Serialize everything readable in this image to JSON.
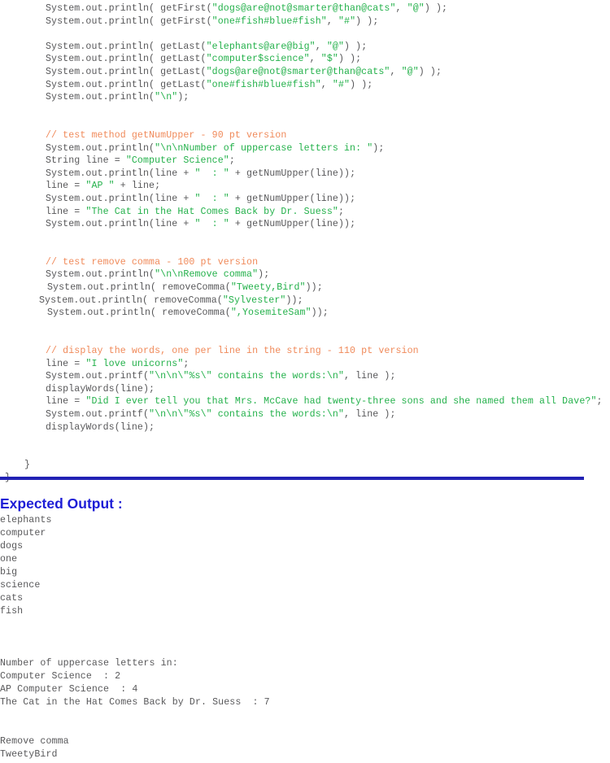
{
  "document": {
    "type": "java-source-listing-with-expected-output",
    "divider_color": "#2222b4",
    "code_text_color": "#58585a",
    "string_literal_color": "#24b14b",
    "comment_color": "#f08a5a",
    "heading_color": "#1d1dd6"
  },
  "code": {
    "lines": [
      {
        "indent": 56,
        "parts": [
          {
            "t": "plain",
            "s": "System.out.println( getFirst("
          },
          {
            "t": "str",
            "s": "\"dogs@are@not@smarter@than@cats\""
          },
          {
            "t": "plain",
            "s": ", "
          },
          {
            "t": "str",
            "s": "\"@\""
          },
          {
            "t": "plain",
            "s": ") );"
          }
        ]
      },
      {
        "indent": 56,
        "parts": [
          {
            "t": "plain",
            "s": "System.out.println( getFirst("
          },
          {
            "t": "str",
            "s": "\"one#fish#blue#fish\""
          },
          {
            "t": "plain",
            "s": ", "
          },
          {
            "t": "str",
            "s": "\"#\""
          },
          {
            "t": "plain",
            "s": ") );"
          }
        ]
      },
      {
        "indent": 0,
        "blank": true,
        "parts": []
      },
      {
        "indent": 56,
        "parts": [
          {
            "t": "plain",
            "s": "System.out.println( getLast("
          },
          {
            "t": "str",
            "s": "\"elephants@are@big\""
          },
          {
            "t": "plain",
            "s": ", "
          },
          {
            "t": "str",
            "s": "\"@\""
          },
          {
            "t": "plain",
            "s": ") );"
          }
        ]
      },
      {
        "indent": 56,
        "parts": [
          {
            "t": "plain",
            "s": "System.out.println( getLast("
          },
          {
            "t": "str",
            "s": "\"computer$science\""
          },
          {
            "t": "plain",
            "s": ", "
          },
          {
            "t": "str",
            "s": "\"$\""
          },
          {
            "t": "plain",
            "s": ") );"
          }
        ]
      },
      {
        "indent": 56,
        "parts": [
          {
            "t": "plain",
            "s": "System.out.println( getLast("
          },
          {
            "t": "str",
            "s": "\"dogs@are@not@smarter@than@cats\""
          },
          {
            "t": "plain",
            "s": ", "
          },
          {
            "t": "str",
            "s": "\"@\""
          },
          {
            "t": "plain",
            "s": ") );"
          }
        ]
      },
      {
        "indent": 56,
        "parts": [
          {
            "t": "plain",
            "s": "System.out.println( getLast("
          },
          {
            "t": "str",
            "s": "\"one#fish#blue#fish\""
          },
          {
            "t": "plain",
            "s": ", "
          },
          {
            "t": "str",
            "s": "\"#\""
          },
          {
            "t": "plain",
            "s": ") );"
          }
        ]
      },
      {
        "indent": 56,
        "parts": [
          {
            "t": "plain",
            "s": "System.out.println("
          },
          {
            "t": "str",
            "s": "\"\\n\""
          },
          {
            "t": "plain",
            "s": ");"
          }
        ]
      },
      {
        "indent": 0,
        "blank": true,
        "parts": []
      },
      {
        "indent": 0,
        "blank": true,
        "parts": []
      },
      {
        "indent": 56,
        "parts": [
          {
            "t": "cmt",
            "s": "// test method getNumUpper - 90 pt version"
          }
        ]
      },
      {
        "indent": 56,
        "parts": [
          {
            "t": "plain",
            "s": "System.out.println("
          },
          {
            "t": "str",
            "s": "\"\\n\\nNumber of uppercase letters in: \""
          },
          {
            "t": "plain",
            "s": ");"
          }
        ]
      },
      {
        "indent": 56,
        "parts": [
          {
            "t": "plain",
            "s": "String line = "
          },
          {
            "t": "str",
            "s": "\"Computer Science\""
          },
          {
            "t": "plain",
            "s": ";"
          }
        ]
      },
      {
        "indent": 56,
        "parts": [
          {
            "t": "plain",
            "s": "System.out.println(line + "
          },
          {
            "t": "str",
            "s": "\"  : \""
          },
          {
            "t": "plain",
            "s": " + getNumUpper(line));"
          }
        ]
      },
      {
        "indent": 56,
        "parts": [
          {
            "t": "plain",
            "s": "line = "
          },
          {
            "t": "str",
            "s": "\"AP \""
          },
          {
            "t": "plain",
            "s": " + line;"
          }
        ]
      },
      {
        "indent": 56,
        "parts": [
          {
            "t": "plain",
            "s": "System.out.println(line + "
          },
          {
            "t": "str",
            "s": "\"  : \""
          },
          {
            "t": "plain",
            "s": " + getNumUpper(line));"
          }
        ]
      },
      {
        "indent": 56,
        "parts": [
          {
            "t": "plain",
            "s": "line = "
          },
          {
            "t": "str",
            "s": "\"The Cat in the Hat Comes Back by Dr. Suess\""
          },
          {
            "t": "plain",
            "s": ";"
          }
        ]
      },
      {
        "indent": 56,
        "parts": [
          {
            "t": "plain",
            "s": "System.out.println(line + "
          },
          {
            "t": "str",
            "s": "\"  : \""
          },
          {
            "t": "plain",
            "s": " + getNumUpper(line));"
          }
        ]
      },
      {
        "indent": 0,
        "blank": true,
        "parts": []
      },
      {
        "indent": 0,
        "blank": true,
        "parts": []
      },
      {
        "indent": 56,
        "parts": [
          {
            "t": "cmt",
            "s": "// test remove comma - 100 pt version"
          }
        ]
      },
      {
        "indent": 56,
        "parts": [
          {
            "t": "plain",
            "s": "System.out.println("
          },
          {
            "t": "str",
            "s": "\"\\n\\nRemove comma\""
          },
          {
            "t": "plain",
            "s": ");"
          }
        ]
      },
      {
        "indent": 58,
        "parts": [
          {
            "t": "plain",
            "s": "System.out.println( removeComma("
          },
          {
            "t": "str",
            "s": "\"Tweety,Bird\""
          },
          {
            "t": "plain",
            "s": "));"
          }
        ]
      },
      {
        "indent": 48,
        "parts": [
          {
            "t": "plain",
            "s": "System.out.println( removeComma("
          },
          {
            "t": "str",
            "s": "\"Sylvester\""
          },
          {
            "t": "plain",
            "s": "));"
          }
        ]
      },
      {
        "indent": 58,
        "parts": [
          {
            "t": "plain",
            "s": "System.out.println( removeComma("
          },
          {
            "t": "str",
            "s": "\",YosemiteSam\""
          },
          {
            "t": "plain",
            "s": "));"
          }
        ]
      },
      {
        "indent": 0,
        "blank": true,
        "parts": []
      },
      {
        "indent": 0,
        "blank": true,
        "parts": []
      },
      {
        "indent": 56,
        "parts": [
          {
            "t": "cmt",
            "s": "// display the words, one per line in the string - 110 pt version"
          }
        ]
      },
      {
        "indent": 56,
        "parts": [
          {
            "t": "plain",
            "s": "line = "
          },
          {
            "t": "str",
            "s": "\"I love unicorns\""
          },
          {
            "t": "plain",
            "s": ";"
          }
        ]
      },
      {
        "indent": 56,
        "parts": [
          {
            "t": "plain",
            "s": "System.out.printf("
          },
          {
            "t": "str",
            "s": "\"\\n\\n\\\"%s\\\" contains the words:\\n\""
          },
          {
            "t": "plain",
            "s": ", line );"
          }
        ]
      },
      {
        "indent": 56,
        "parts": [
          {
            "t": "plain",
            "s": "displayWords(line);"
          }
        ]
      },
      {
        "indent": 56,
        "wrap": true,
        "parts": [
          {
            "t": "plain",
            "s": "line = "
          },
          {
            "t": "str",
            "s": "\"Did I ever tell you that Mrs. McCave had twenty-three sons and she named them all Dave?\""
          },
          {
            "t": "plain",
            "s": ";"
          }
        ]
      },
      {
        "indent": 56,
        "parts": [
          {
            "t": "plain",
            "s": "System.out.printf("
          },
          {
            "t": "str",
            "s": "\"\\n\\n\\\"%s\\\" contains the words:\\n\""
          },
          {
            "t": "plain",
            "s": ", line );"
          }
        ]
      },
      {
        "indent": 56,
        "parts": [
          {
            "t": "plain",
            "s": "displayWords(line);"
          }
        ]
      },
      {
        "indent": 0,
        "blank": true,
        "parts": []
      },
      {
        "indent": 0,
        "blank": true,
        "parts": []
      },
      {
        "indent": 30,
        "parts": [
          {
            "t": "plain",
            "s": "}"
          }
        ]
      },
      {
        "indent": 6,
        "parts": [
          {
            "t": "plain",
            "s": "}"
          }
        ]
      }
    ]
  },
  "expected_output": {
    "heading": "Expected Output :",
    "lines": [
      "elephants",
      "computer",
      "dogs",
      "one",
      "big",
      "science",
      "cats",
      "fish",
      "",
      "",
      "",
      "Number of uppercase letters in:",
      "Computer Science  : 2",
      "AP Computer Science  : 4",
      "The Cat in the Hat Comes Back by Dr. Suess  : 7",
      "",
      "",
      "Remove comma",
      "TweetyBird"
    ]
  }
}
